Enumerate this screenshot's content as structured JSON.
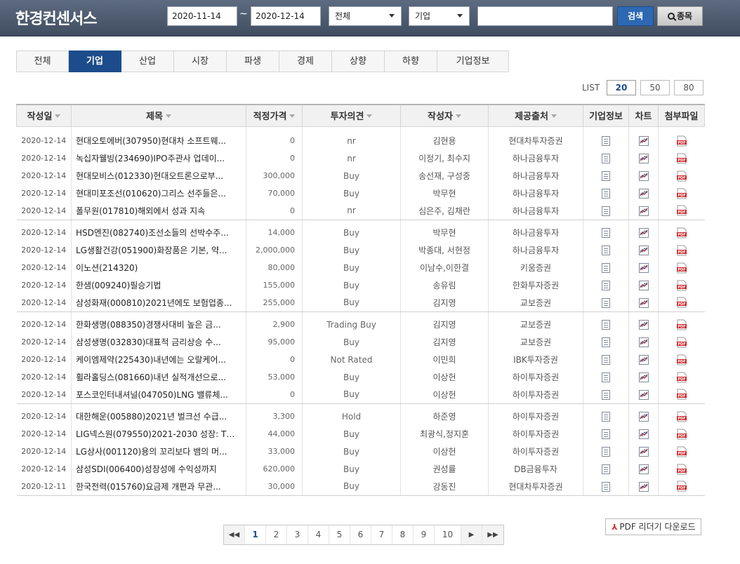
{
  "header": {
    "logo": "한경컨센서스",
    "date_from": "2020-11-14",
    "date_tilde": "~",
    "date_to": "2020-12-14",
    "type_select": "전체",
    "category_select": "기업",
    "search_value": "",
    "search_button": "검색",
    "stock_button": "종목"
  },
  "tabs": [
    {
      "label": "전체"
    },
    {
      "label": "기업",
      "active": true
    },
    {
      "label": "산업"
    },
    {
      "label": "시장"
    },
    {
      "label": "파생"
    },
    {
      "label": "경제"
    },
    {
      "label": "상향"
    },
    {
      "label": "하향"
    },
    {
      "label": "기업정보"
    }
  ],
  "list": {
    "label": "LIST",
    "options": [
      "20",
      "50",
      "80"
    ],
    "selected": "20"
  },
  "table": {
    "headers": [
      "작성일",
      "제목",
      "적정가격",
      "투자의견",
      "작성자",
      "제공출처",
      "기업정보",
      "차트",
      "첨부파일"
    ],
    "rows": [
      {
        "date": "2020-12-14",
        "title": "현대오토에버(307950)현대차 소프트웨...",
        "price": "0",
        "opinion": "nr",
        "author": "김현용",
        "provider": "현대차투자증권"
      },
      {
        "date": "2020-12-14",
        "title": "녹십자웰빙(234690)IPO주관사 업데이...",
        "price": "0",
        "opinion": "nr",
        "author": "이정기, 최수지",
        "provider": "하나금융투자"
      },
      {
        "date": "2020-12-14",
        "title": "현대모비스(012330)현대오트론으로부...",
        "price": "300,000",
        "opinion": "Buy",
        "author": "송선재, 구성중",
        "provider": "하나금융투자"
      },
      {
        "date": "2020-12-14",
        "title": "현대미포조선(010620)그리스 선주들은...",
        "price": "70,000",
        "opinion": "Buy",
        "author": "박무현",
        "provider": "하나금융투자"
      },
      {
        "date": "2020-12-14",
        "title": "폴무원(017810)해외에서 성과 지속",
        "price": "0",
        "opinion": "nr",
        "author": "심은주, 김채란",
        "provider": "하나금융투자"
      },
      {
        "date": "2020-12-14",
        "title": "HSD엔진(082740)조선소들의 선박수주...",
        "price": "14,000",
        "opinion": "Buy",
        "author": "박무현",
        "provider": "하나금융투자"
      },
      {
        "date": "2020-12-14",
        "title": "LG생활건강(051900)화장품은 기본, 약...",
        "price": "2,000,000",
        "opinion": "Buy",
        "author": "박종대, 서현정",
        "provider": "하나금융투자"
      },
      {
        "date": "2020-12-14",
        "title": "이노션(214320)",
        "price": "80,000",
        "opinion": "Buy",
        "author": "이남수,이한결",
        "provider": "키움증권"
      },
      {
        "date": "2020-12-14",
        "title": "한샘(009240)필승기법",
        "price": "155,000",
        "opinion": "Buy",
        "author": "송유림",
        "provider": "한화투자증권"
      },
      {
        "date": "2020-12-14",
        "title": "삼성화재(000810)2021년에도 보험업종...",
        "price": "255,000",
        "opinion": "Buy",
        "author": "김지영",
        "provider": "교보증권"
      },
      {
        "date": "2020-12-14",
        "title": "한화생명(088350)경쟁사대비 높은 금...",
        "price": "2,900",
        "opinion": "Trading Buy",
        "author": "김지영",
        "provider": "교보증권"
      },
      {
        "date": "2020-12-14",
        "title": "삼성생명(032830)대표적 금리상승 수...",
        "price": "95,000",
        "opinion": "Buy",
        "author": "김지영",
        "provider": "교보증권"
      },
      {
        "date": "2020-12-14",
        "title": "케이엠제약(225430)내년에는 오랄케어...",
        "price": "0",
        "opinion": "Not Rated",
        "author": "이민희",
        "provider": "IBK투자증권"
      },
      {
        "date": "2020-12-14",
        "title": "휠라홀딩스(081660)내년 실적개선으로...",
        "price": "53,000",
        "opinion": "Buy",
        "author": "이상헌",
        "provider": "하이투자증권"
      },
      {
        "date": "2020-12-14",
        "title": "포스코인터내셔널(047050)LNG 밸류체...",
        "price": "0",
        "opinion": "Buy",
        "author": "이상헌",
        "provider": "하이투자증권"
      },
      {
        "date": "2020-12-14",
        "title": "대한해운(005880)2021년 벌크선 수급...",
        "price": "3,300",
        "opinion": "Hold",
        "author": "하준영",
        "provider": "하이투자증권"
      },
      {
        "date": "2020-12-14",
        "title": "LIG넥스원(079550)2021-2030 성장: TM...",
        "price": "44,000",
        "opinion": "Buy",
        "author": "최광식,정지훈",
        "provider": "하이투자증권"
      },
      {
        "date": "2020-12-14",
        "title": "LG상사(001120)용의 꼬리보다 뱀의 머...",
        "price": "33,000",
        "opinion": "Buy",
        "author": "이상헌",
        "provider": "하이투자증권"
      },
      {
        "date": "2020-12-14",
        "title": "삼성SDI(006400)성장성에 수익성까지",
        "price": "620,000",
        "opinion": "Buy",
        "author": "권성률",
        "provider": "DB금융투자"
      },
      {
        "date": "2020-12-11",
        "title": "한국전력(015760)요금제 개편과 무관...",
        "price": "30,000",
        "opinion": "Buy",
        "author": "강동진",
        "provider": "현대차투자증권"
      }
    ]
  },
  "pagination": {
    "pages": [
      "1",
      "2",
      "3",
      "4",
      "5",
      "6",
      "7",
      "8",
      "9",
      "10"
    ],
    "current": "1"
  },
  "pdf_reader": {
    "label": "PDF 리더기 다운로드"
  },
  "icons": {
    "company_info": "document-icon",
    "chart": "chart-icon",
    "attachment": "pdf-icon"
  },
  "colors": {
    "header_bg": "#4b586c",
    "tab_active": "#1c4c8c",
    "search_button": "#2d68b3"
  }
}
